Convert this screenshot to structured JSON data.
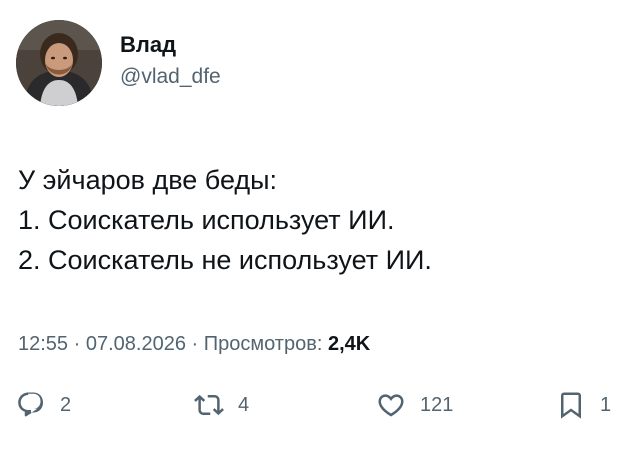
{
  "author": {
    "display_name": "Влад",
    "handle": "@vlad_dfe"
  },
  "tweet": {
    "lines": [
      "У эйчаров две беды:",
      "1. Соискатель использует ИИ.",
      "2. Соискатель не использует ИИ."
    ]
  },
  "meta": {
    "time": "12:55",
    "separator": " · ",
    "date": "07.08.2026",
    "views_label": "Просмотров:",
    "views_count": "2,4K"
  },
  "actions": {
    "replies": "2",
    "retweets": "4",
    "likes": "121",
    "bookmarks": "1",
    "icons": [
      "reply-icon",
      "retweet-icon",
      "like-icon",
      "bookmark-icon"
    ]
  },
  "colors": {
    "text": "#0f1419",
    "secondary": "#536471",
    "background": "#ffffff"
  }
}
